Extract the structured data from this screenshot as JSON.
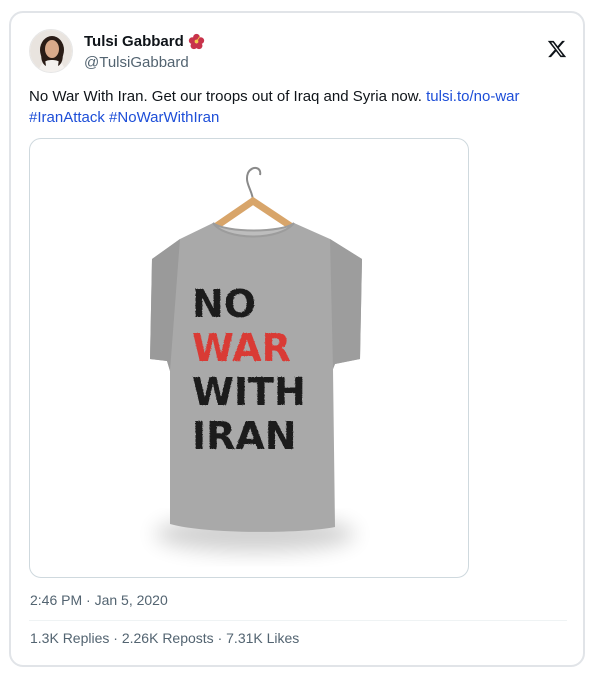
{
  "author": {
    "name": "Tulsi Gabbard",
    "handle": "@TulsiGabbard",
    "emoji_icon": "hibiscus-flower-icon"
  },
  "platform_icon": "x-logo-icon",
  "tweet": {
    "text": "No War With Iran. Get our troops out of Iraq and Syria now.",
    "link": "tulsi.to/no-war",
    "hashtags": [
      "#IranAttack",
      "#NoWarWithIran"
    ]
  },
  "media": {
    "shirt_text_lines": [
      "NO",
      "WAR",
      "WITH",
      "IRAN"
    ],
    "colors": {
      "shirt": "#a9a9a9",
      "ink_black": "#1a1a1a",
      "ink_red": "#d93a35",
      "hanger": "#d8a56a"
    }
  },
  "timestamp": "2:46 PM · Jan 5, 2020",
  "stats": {
    "replies": "1.3K Replies",
    "reposts": "2.26K Reposts",
    "likes": "7.31K Likes",
    "separator": " · "
  },
  "colors": {
    "link": "#1d4ed8",
    "muted": "#536471",
    "border": "#e1e4e8"
  }
}
